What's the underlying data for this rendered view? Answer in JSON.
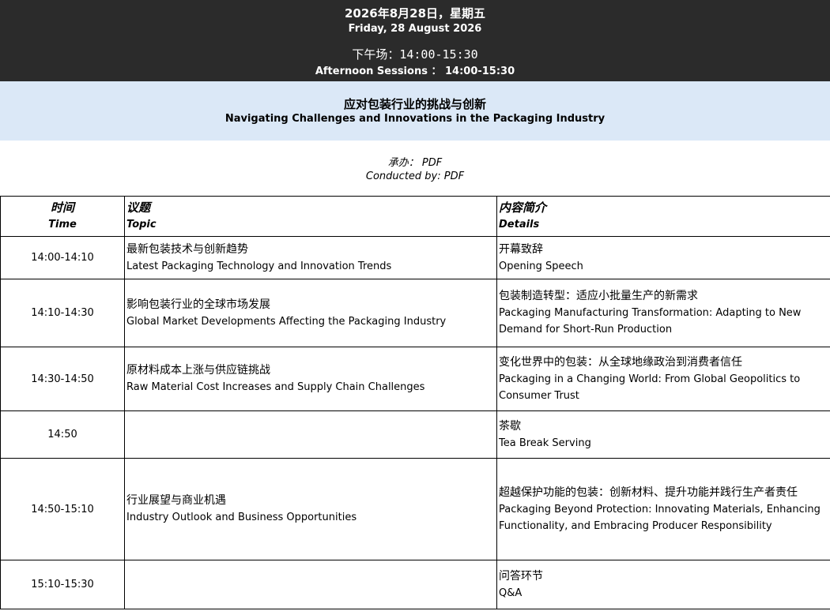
{
  "header": {
    "date_zh": "2026年8月28日，星期五",
    "date_en": "Friday, 28 August 2026",
    "session_zh": "下午场：14:00-15:30",
    "session_en": "Afternoon Sessions ： 14:00-15:30"
  },
  "title": {
    "zh": "应对包装行业的挑战与创新",
    "en": "Navigating Challenges and Innovations in the Packaging Industry"
  },
  "conducted": {
    "zh": "承办：  PDF",
    "en": "Conducted by: PDF"
  },
  "table": {
    "headers": {
      "time_zh": "时间",
      "time_en": "Time",
      "topic_zh": "议题",
      "topic_en": "Topic",
      "details_zh": "内容简介",
      "details_en": "Details"
    },
    "rows": [
      {
        "time": "14:00-14:10",
        "topic_zh": "最新包装技术与创新趋势",
        "topic_en": "Latest Packaging Technology and Innovation Trends",
        "details_zh": "开幕致辞",
        "details_en": "Opening Speech"
      },
      {
        "time": "14:10-14:30",
        "topic_zh": "影响包装行业的全球市场发展",
        "topic_en": "Global Market Developments Affecting the Packaging Industry",
        "details_zh": "包装制造转型：适应小批量生产的新需求",
        "details_en": "Packaging Manufacturing Transformation: Adapting to New Demand for Short-Run Production"
      },
      {
        "time": "14:30-14:50",
        "topic_zh": "原材料成本上涨与供应链挑战",
        "topic_en": "Raw Material Cost Increases and Supply Chain Challenges",
        "details_zh": "变化世界中的包装：从全球地缘政治到消费者信任",
        "details_en": "Packaging in a Changing World: From Global Geopolitics to Consumer Trust"
      },
      {
        "time": "14:50",
        "topic_zh": "",
        "topic_en": "",
        "details_zh": "茶歇",
        "details_en": "Tea Break Serving"
      },
      {
        "time": "14:50-15:10",
        "topic_zh": "行业展望与商业机遇",
        "topic_en": "Industry Outlook and Business Opportunities",
        "details_zh": "超越保护功能的包装：创新材料、提升功能并践行生产者责任",
        "details_en": "Packaging Beyond Protection: Innovating Materials, Enhancing Functionality, and Embracing Producer Responsibility"
      },
      {
        "time": "15:10-15:30",
        "topic_zh": "",
        "topic_en": "",
        "details_zh": "问答环节",
        "details_en": "Q&A"
      }
    ]
  }
}
